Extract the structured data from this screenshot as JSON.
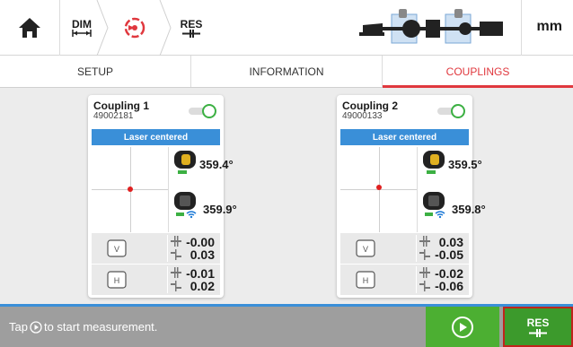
{
  "nav": {
    "dim_label": "DIM",
    "res_label": "RES",
    "unit": "mm"
  },
  "tabs": [
    {
      "label": "SETUP",
      "active": false
    },
    {
      "label": "INFORMATION",
      "active": false
    },
    {
      "label": "COUPLINGS",
      "active": true
    }
  ],
  "colors": {
    "accent_red": "#e0383e",
    "banner_blue": "#3a8fd8",
    "play_green": "#4caf32",
    "toggle_green": "#3cb043"
  },
  "couplings": [
    {
      "title": "Coupling 1",
      "serial": "49002181",
      "status": "Laser centered",
      "sensor_top_angle": "359.4°",
      "sensor_bottom_angle": "359.9°",
      "vertical": {
        "a": "-0.00",
        "b": "0.03"
      },
      "horizontal": {
        "a": "-0.01",
        "b": "0.02"
      }
    },
    {
      "title": "Coupling 2",
      "serial": "49000133",
      "status": "Laser centered",
      "sensor_top_angle": "359.5°",
      "sensor_bottom_angle": "359.8°",
      "vertical": {
        "a": "0.03",
        "b": "-0.05"
      },
      "horizontal": {
        "a": "-0.02",
        "b": "-0.06"
      }
    }
  ],
  "bottom": {
    "hint_pre": "Tap",
    "hint_post": "to start measurement.",
    "res_label": "RES"
  }
}
